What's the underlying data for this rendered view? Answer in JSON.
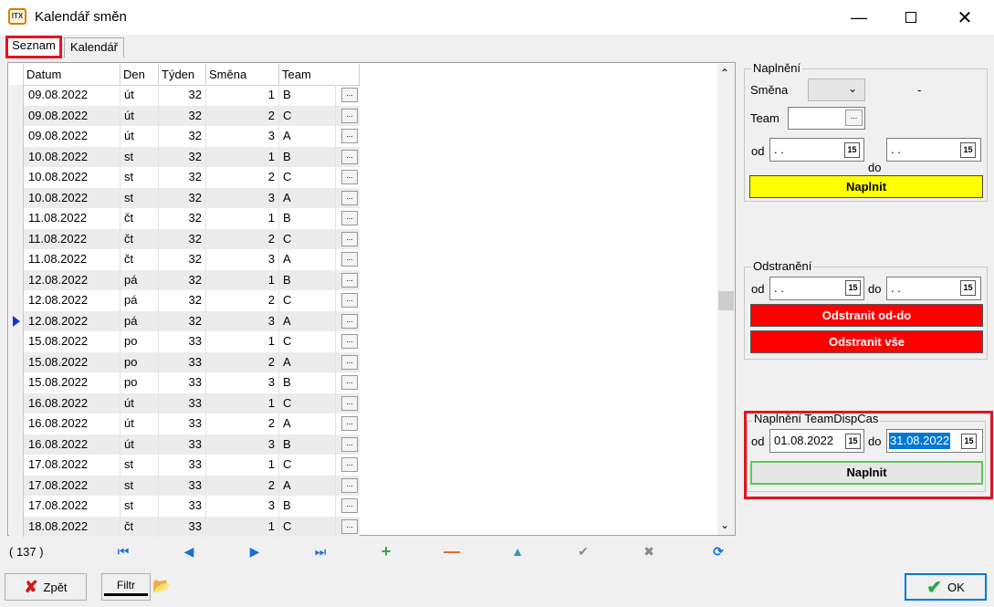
{
  "window": {
    "title": "Kalendář směn",
    "icon": "ITX"
  },
  "tabs": [
    {
      "label": "Seznam"
    },
    {
      "label": "Kalendář"
    }
  ],
  "grid": {
    "columns": [
      "Datum",
      "Den",
      "Týden",
      "Směna",
      "Team"
    ],
    "rows": [
      [
        "09.08.2022",
        "út",
        "32",
        "1",
        "B"
      ],
      [
        "09.08.2022",
        "út",
        "32",
        "2",
        "C"
      ],
      [
        "09.08.2022",
        "út",
        "32",
        "3",
        "A"
      ],
      [
        "10.08.2022",
        "st",
        "32",
        "1",
        "B"
      ],
      [
        "10.08.2022",
        "st",
        "32",
        "2",
        "C"
      ],
      [
        "10.08.2022",
        "st",
        "32",
        "3",
        "A"
      ],
      [
        "11.08.2022",
        "čt",
        "32",
        "1",
        "B"
      ],
      [
        "11.08.2022",
        "čt",
        "32",
        "2",
        "C"
      ],
      [
        "11.08.2022",
        "čt",
        "32",
        "3",
        "A"
      ],
      [
        "12.08.2022",
        "pá",
        "32",
        "1",
        "B"
      ],
      [
        "12.08.2022",
        "pá",
        "32",
        "2",
        "C"
      ],
      [
        "12.08.2022",
        "pá",
        "32",
        "3",
        "A"
      ],
      [
        "15.08.2022",
        "po",
        "33",
        "1",
        "C"
      ],
      [
        "15.08.2022",
        "po",
        "33",
        "2",
        "A"
      ],
      [
        "15.08.2022",
        "po",
        "33",
        "3",
        "B"
      ],
      [
        "16.08.2022",
        "út",
        "33",
        "1",
        "C"
      ],
      [
        "16.08.2022",
        "út",
        "33",
        "2",
        "A"
      ],
      [
        "16.08.2022",
        "út",
        "33",
        "3",
        "B"
      ],
      [
        "17.08.2022",
        "st",
        "33",
        "1",
        "C"
      ],
      [
        "17.08.2022",
        "st",
        "33",
        "2",
        "A"
      ],
      [
        "17.08.2022",
        "st",
        "33",
        "3",
        "B"
      ],
      [
        "18.08.2022",
        "čt",
        "33",
        "1",
        "C"
      ]
    ],
    "row_button": "...",
    "count": "( 137 )"
  },
  "naplneni": {
    "title": "Naplnění",
    "smena_label": "Směna",
    "dash": "-",
    "team_label": "Team",
    "team_btn": "...",
    "od_label": "od",
    "do_label": "do",
    "od_value": " .  .",
    "do_value": " .  .",
    "button": "Naplnit"
  },
  "odstraneni": {
    "title": "Odstranění",
    "od_label": "od",
    "do_label": "do",
    "od_value": " .  .",
    "do_value": " .  .",
    "btn_range": "Odstranit od-do",
    "btn_all": "Odstranit vše"
  },
  "disp": {
    "title": "Naplnění TeamDispCas",
    "od_label": "od",
    "do_label": "do",
    "od_value": "01.08.2022",
    "do_value": "31.08.2022",
    "button": "Naplnit"
  },
  "cal_icon": "15",
  "bottom": {
    "back": "Zpět",
    "filter": "Filtr",
    "ok": "OK"
  },
  "colors": {
    "highlight": "#e3141e",
    "yellow": "#ffff00",
    "red": "#ff0000",
    "green_border": "#5ac75a",
    "select_blue": "#0078d7"
  }
}
